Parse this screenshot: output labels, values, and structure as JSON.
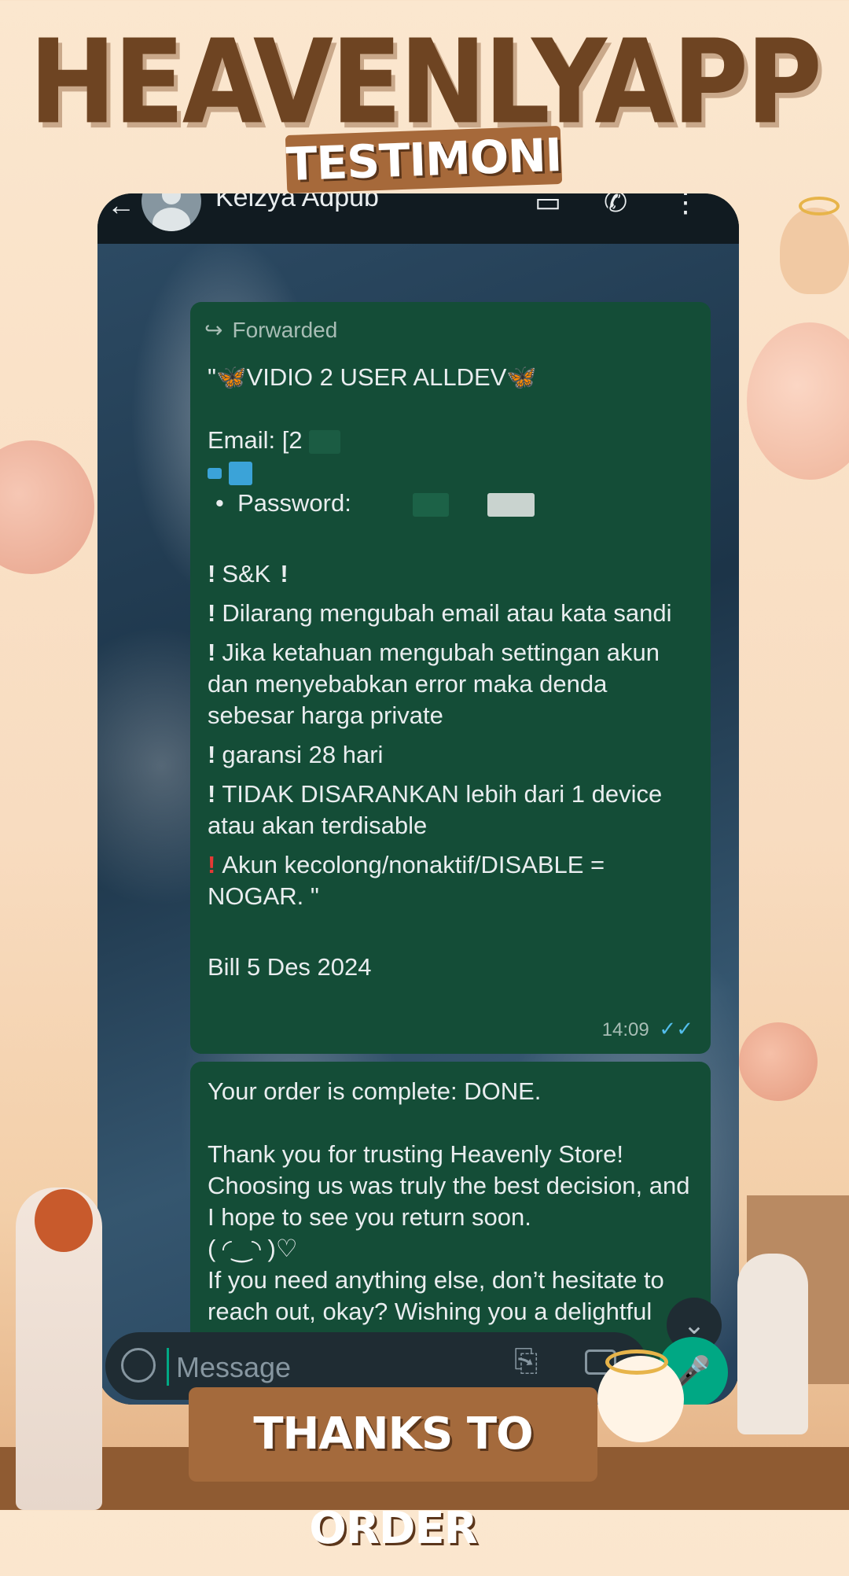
{
  "poster": {
    "brand": "HEAVENLYAPP",
    "subtitle": "TESTIMONI",
    "footer": "THANKS TO ORDER"
  },
  "chat_header": {
    "contact_name": "Keizya Adpub",
    "back_icon": "back-arrow-icon",
    "video_icon": "video-call-icon",
    "phone_icon": "phone-call-icon",
    "menu_icon": "more-vert-icon"
  },
  "message1": {
    "forwarded_label": "Forwarded",
    "title": "\"🦋VIDIO 2 USER ALLDEV🦋",
    "email_label": "Email: [2",
    "password_label": "Password:",
    "sk": "S&K",
    "rule1": "Dilarang mengubah email atau kata sandi",
    "rule2": "Jika ketahuan mengubah settingan akun dan menyebabkan error maka denda sebesar harga private",
    "rule3": "garansi 28 hari",
    "rule4": "TIDAK DISARANKAN lebih dari 1 device atau akan terdisable",
    "rule5": "Akun kecolong/nonaktif/DISABLE = NOGAR. \"",
    "bill": "Bill 5 Des 2024",
    "time": "14:09",
    "status": "read"
  },
  "message2": {
    "line1": "Your order is complete: DONE.",
    "line2": "Thank you for trusting Heavenly Store! Choosing us was truly the best decision, and I hope to see you return soon.",
    "kaomoji": "( ◜‿◝ )♡",
    "line3": "If you need anything else, don’t hesitate to reach out, okay? Wishing you a delightful day!"
  },
  "input": {
    "placeholder": "Message"
  },
  "colors": {
    "bubble": "#144d37",
    "accent": "#00a884",
    "brand_brown": "#6e4422",
    "badge_brown": "#a6693a"
  }
}
